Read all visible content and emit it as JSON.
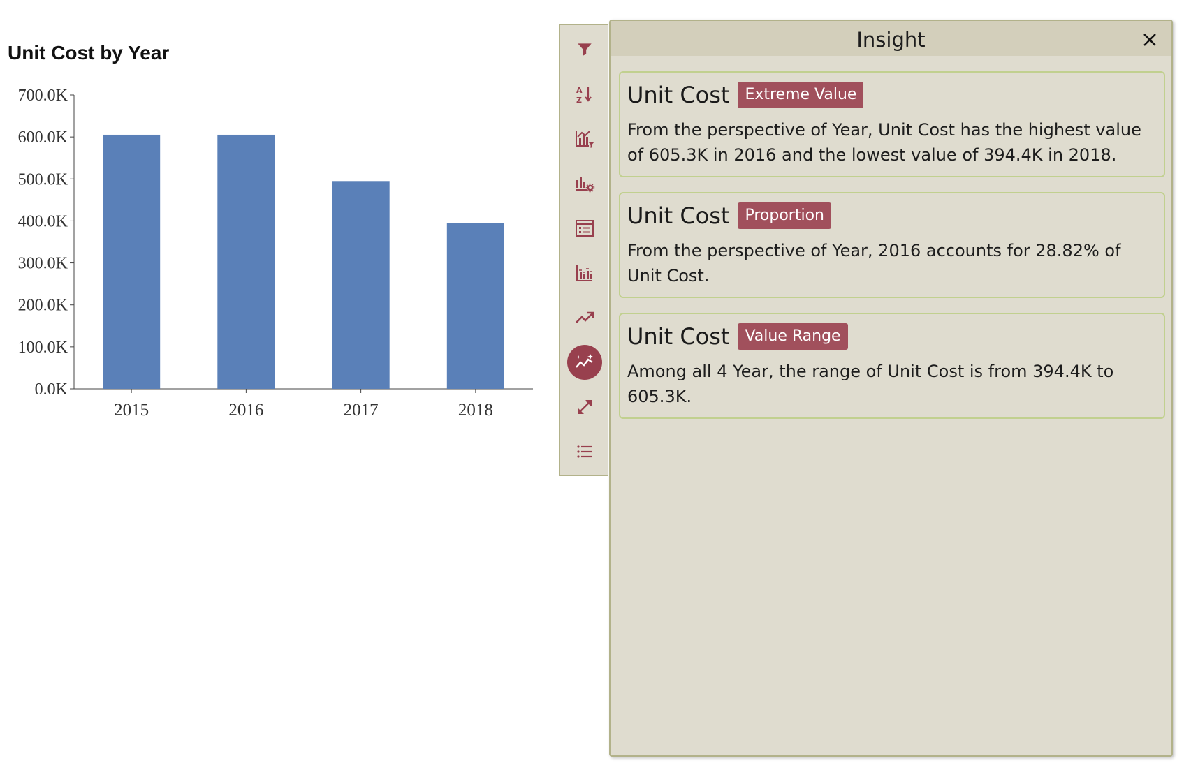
{
  "chart_data": {
    "type": "bar",
    "title": "Unit Cost by Year",
    "categories": [
      "2015",
      "2016",
      "2017",
      "2018"
    ],
    "values": [
      605.3,
      605.3,
      495.0,
      394.4
    ],
    "value_unit": "K",
    "ylim": [
      0,
      700
    ],
    "yticks": [
      "0.0K",
      "100.0K",
      "200.0K",
      "300.0K",
      "400.0K",
      "500.0K",
      "600.0K",
      "700.0K"
    ],
    "color": "#5a80b8",
    "grid": false
  },
  "toolbar": {
    "items": [
      {
        "icon": "filter-icon",
        "active": false
      },
      {
        "icon": "sort-az-icon",
        "active": false
      },
      {
        "icon": "chart-filter-icon",
        "active": false
      },
      {
        "icon": "chart-settings-icon",
        "active": false
      },
      {
        "icon": "data-table-icon",
        "active": false
      },
      {
        "icon": "bar-chart-icon",
        "active": false
      },
      {
        "icon": "trend-icon",
        "active": false
      },
      {
        "icon": "insight-icon",
        "active": true
      },
      {
        "icon": "expand-icon",
        "active": false
      },
      {
        "icon": "list-icon",
        "active": false
      }
    ],
    "accent": "#98404e"
  },
  "panel": {
    "title": "Insight",
    "cards": [
      {
        "metric": "Unit Cost",
        "tag": "Extreme Value",
        "text": "From the perspective of Year, Unit Cost has the highest value of 605.3K in 2016 and the lowest value of 394.4K in 2018."
      },
      {
        "metric": "Unit Cost",
        "tag": "Proportion",
        "text": "From the perspective of Year, 2016 accounts for 28.82% of Unit Cost."
      },
      {
        "metric": "Unit Cost",
        "tag": "Value Range",
        "text": "Among all 4 Year, the range of Unit Cost is from 394.4K to 605.3K."
      }
    ]
  }
}
